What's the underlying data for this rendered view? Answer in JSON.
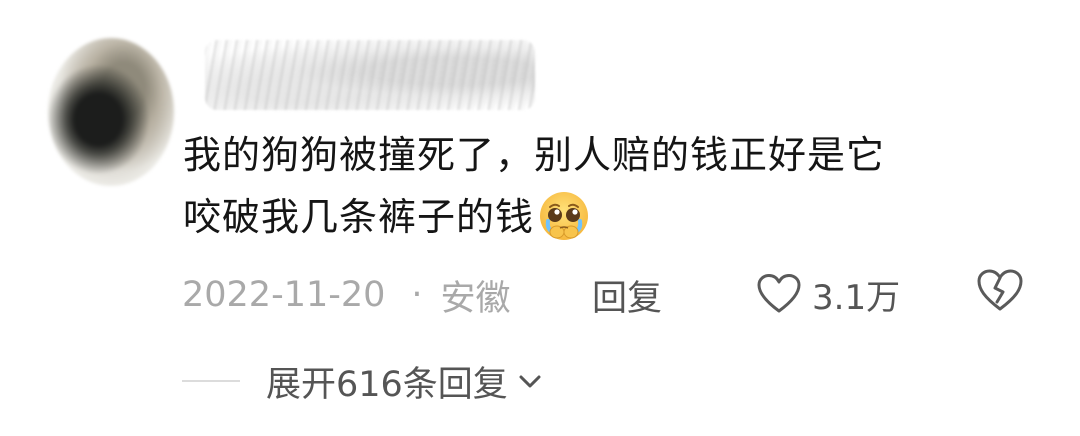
{
  "comment": {
    "text_line1": "我的狗狗被撞死了，别人赔的钱正好是它",
    "text_line2": "咬破我几条裤子的钱",
    "emoji": "pleading-face-holding-back-tears"
  },
  "meta": {
    "date": "2022-11-20",
    "separator": "·",
    "location": "安徽"
  },
  "actions": {
    "reply_label": "回复",
    "like_count": "3.1万",
    "like_icon": "heart-outline-icon",
    "dislike_icon": "broken-heart-icon"
  },
  "replies": {
    "expand_label": "展开616条回复",
    "chevron_icon": "chevron-down-icon"
  },
  "colors": {
    "text_primary": "#151515",
    "text_secondary": "#a9a9a9",
    "action_text": "#555555",
    "divider": "#dcdcdc"
  }
}
